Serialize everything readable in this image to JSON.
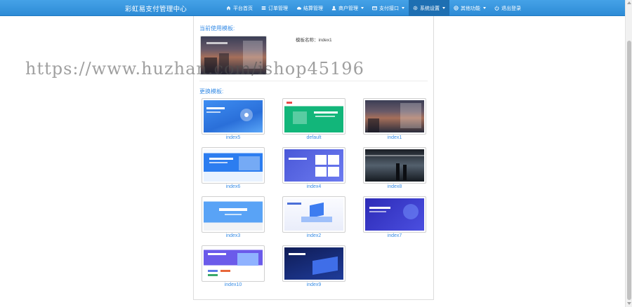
{
  "navbar": {
    "brand": "彩虹易支付管理中心",
    "items": [
      {
        "label": "平台首页",
        "icon": "home-icon",
        "dropdown": false,
        "active": false
      },
      {
        "label": "订单管理",
        "icon": "list-icon",
        "dropdown": false,
        "active": false
      },
      {
        "label": "结算管理",
        "icon": "cloud-icon",
        "dropdown": false,
        "active": false
      },
      {
        "label": "商户管理",
        "icon": "user-icon",
        "dropdown": true,
        "active": false
      },
      {
        "label": "支付接口",
        "icon": "card-icon",
        "dropdown": true,
        "active": false
      },
      {
        "label": "系统设置",
        "icon": "gear-icon",
        "dropdown": true,
        "active": true
      },
      {
        "label": "其他功能",
        "icon": "globe-icon",
        "dropdown": true,
        "active": false
      },
      {
        "label": "退出登录",
        "icon": "power-icon",
        "dropdown": false,
        "active": false
      }
    ]
  },
  "current": {
    "title": "当前使用模板:",
    "name": "模板名称：index1"
  },
  "change": {
    "title": "更换模板:",
    "templates": [
      {
        "name": "index5",
        "art": "art-blue"
      },
      {
        "name": "default",
        "art": "art-green"
      },
      {
        "name": "index1",
        "art": "art-city"
      },
      {
        "name": "index6",
        "art": "art-lightblue"
      },
      {
        "name": "index4",
        "art": "art-purple"
      },
      {
        "name": "index8",
        "art": "art-dark"
      },
      {
        "name": "index3",
        "art": "art-sky"
      },
      {
        "name": "index2",
        "art": "art-iso"
      },
      {
        "name": "index7",
        "art": "art-violet"
      },
      {
        "name": "index10",
        "art": "art-purple2"
      },
      {
        "name": "index9",
        "art": "art-night"
      }
    ]
  },
  "watermark": "https://www.huzhan.com/ishop45196",
  "colors": {
    "navbar": "#3597e0",
    "active_nav": "#1e6fb2",
    "link": "#3a8ee6"
  }
}
